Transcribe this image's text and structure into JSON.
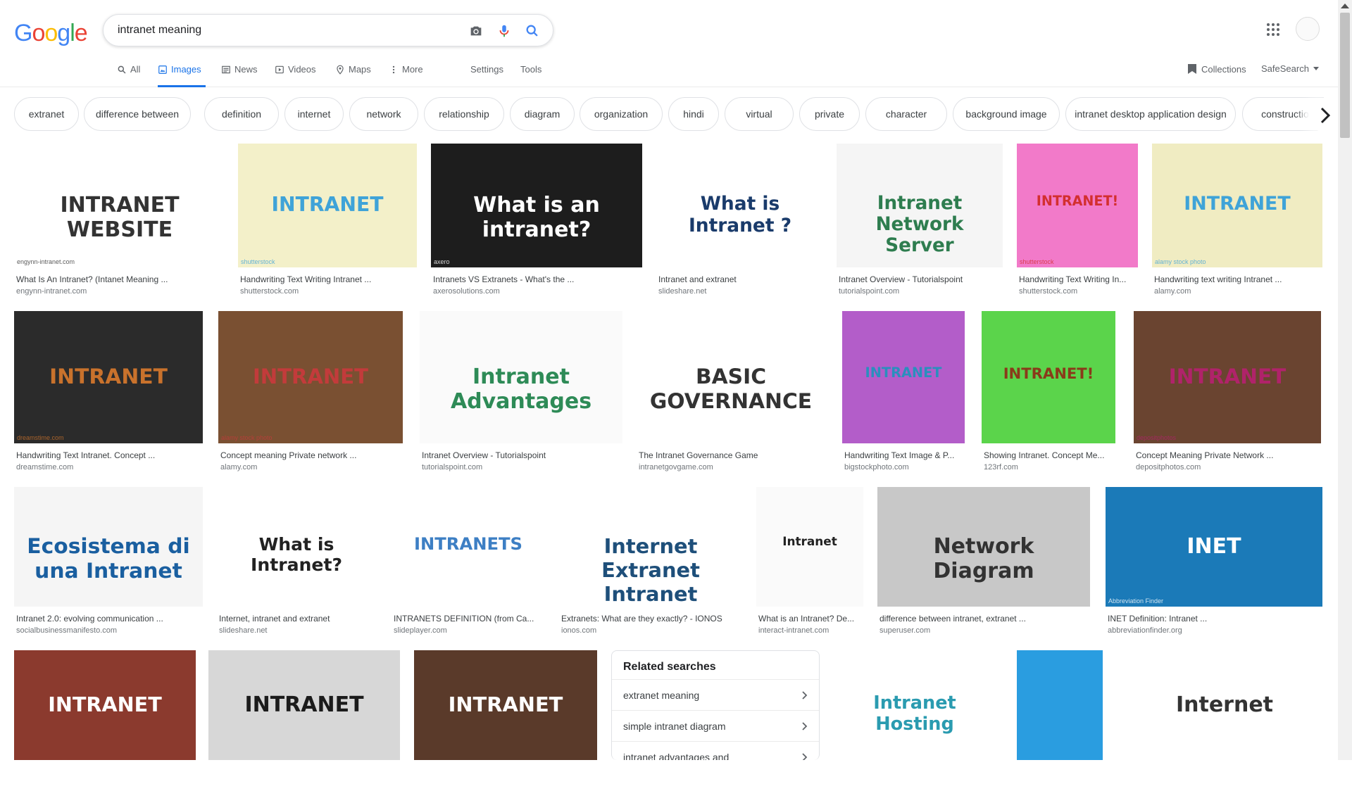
{
  "search": {
    "query": "intranet meaning"
  },
  "logo": {
    "letters": [
      "G",
      "o",
      "o",
      "g",
      "l",
      "e"
    ],
    "colors": [
      "#4285F4",
      "#EA4335",
      "#FBBC05",
      "#4285F4",
      "#34A853",
      "#EA4335"
    ]
  },
  "tabs": [
    {
      "label": "All",
      "icon": "search-icon"
    },
    {
      "label": "Images",
      "icon": "image-icon"
    },
    {
      "label": "News",
      "icon": "news-icon"
    },
    {
      "label": "Videos",
      "icon": "video-icon"
    },
    {
      "label": "Maps",
      "icon": "map-icon"
    },
    {
      "label": "More",
      "icon": "dots-icon"
    }
  ],
  "tools": {
    "settings": "Settings",
    "tools": "Tools",
    "collections": "Collections",
    "safesearch": "SafeSearch"
  },
  "chips": [
    "extranet",
    "difference between",
    "definition",
    "internet",
    "network",
    "relationship",
    "diagram",
    "organization",
    "hindi",
    "virtual",
    "private",
    "character",
    "background image",
    "intranet desktop application design",
    "construction com"
  ],
  "results": [
    {
      "caption": "What Is An Intranet? (Intanet Meaning ...",
      "source": "engynn-intranet.com",
      "bg": "#ffffff",
      "fg": "#333333",
      "text": "INTRANET   WEBSITE",
      "watermark": "engynn-intranet.com"
    },
    {
      "caption": "Handwriting Text Writing Intranet ...",
      "source": "shutterstock.com",
      "bg": "#f3f0c9",
      "fg": "#3fa3d8",
      "text": "INTRANET",
      "watermark": "shutterstock"
    },
    {
      "caption": "Intranets VS Extranets - What's the ...",
      "source": "axerosolutions.com",
      "bg": "#1d1d1d",
      "fg": "#ffffff",
      "text": "What is an intranet?",
      "watermark": "axero"
    },
    {
      "caption": "Intranet and extranet",
      "source": "slideshare.net",
      "bg": "#ffffff",
      "fg": "#1a3b6b",
      "text": "What is Intranet ?",
      "watermark": ""
    },
    {
      "caption": "Intranet Overview - Tutorialspoint",
      "source": "tutorialspoint.com",
      "bg": "#f5f5f5",
      "fg": "#2e7d4f",
      "text": "Intranet Network Server",
      "watermark": ""
    },
    {
      "caption": "Handwriting Text Writing In...",
      "source": "shutterstock.com",
      "bg": "#f27ac9",
      "fg": "#d32f2f",
      "text": "INTRANET!",
      "watermark": "shutterstock"
    },
    {
      "caption": "Handwriting text writing Intranet ...",
      "source": "alamy.com",
      "bg": "#f0ecc2",
      "fg": "#3fa3d8",
      "text": "INTRANET",
      "watermark": "alamy stock photo"
    },
    {
      "caption": "Handwriting Text Intranet. Concept ...",
      "source": "dreamstime.com",
      "bg": "#2b2b2b",
      "fg": "#c9722c",
      "text": "INTRANET",
      "watermark": "dreamstime.com"
    },
    {
      "caption": "Concept meaning Private network ...",
      "source": "alamy.com",
      "bg": "#7a5032",
      "fg": "#c23b3b",
      "text": "INTRANET",
      "watermark": "alamy stock photo"
    },
    {
      "caption": "Intranet Overview - Tutorialspoint",
      "source": "tutorialspoint.com",
      "bg": "#fafafa",
      "fg": "#2e8b57",
      "text": "Intranet Advantages",
      "watermark": ""
    },
    {
      "caption": "The Intranet Governance Game",
      "source": "intranetgovgame.com",
      "bg": "#ffffff",
      "fg": "#333333",
      "text": "BASIC GOVERNANCE",
      "watermark": ""
    },
    {
      "caption": "Handwriting Text Image & P...",
      "source": "bigstockphoto.com",
      "bg": "#b35dc9",
      "fg": "#2a8fbd",
      "text": "INTRANET",
      "watermark": ""
    },
    {
      "caption": "Showing Intranet. Concept Me...",
      "source": "123rf.com",
      "bg": "#5bd44b",
      "fg": "#8a3a1a",
      "text": "INTRANET!",
      "watermark": ""
    },
    {
      "caption": "Concept Meaning Private Network ...",
      "source": "depositphotos.com",
      "bg": "#6a4430",
      "fg": "#b0236a",
      "text": "INTRANET",
      "watermark": "depositphotos"
    },
    {
      "caption": "Intranet 2.0: evolving communication ...",
      "source": "socialbusinessmanifesto.com",
      "bg": "#f5f5f5",
      "fg": "#1a5fa0",
      "text": "Ecosistema di una Intranet",
      "watermark": ""
    },
    {
      "caption": "Internet, intranet and extranet",
      "source": "slideshare.net",
      "bg": "#ffffff",
      "fg": "#222222",
      "text": "What is Intranet?",
      "watermark": ""
    },
    {
      "caption": "INTRANETS DEFINITION (from Ca...",
      "source": "slideplayer.com",
      "bg": "#ffffff",
      "fg": "#3d7fc4",
      "text": "INTRANETS",
      "watermark": ""
    },
    {
      "caption": "Extranets: What are they exactly? - IONOS",
      "source": "ionos.com",
      "bg": "#ffffff",
      "fg": "#1e4f7a",
      "text": "Internet Extranet Intranet",
      "watermark": ""
    },
    {
      "caption": "What is an Intranet? De...",
      "source": "interact-intranet.com",
      "bg": "#fafafa",
      "fg": "#222222",
      "text": "Intranet",
      "watermark": ""
    },
    {
      "caption": "difference between intranet, extranet ...",
      "source": "superuser.com",
      "bg": "#c8c8c8",
      "fg": "#333333",
      "text": "Network Diagram",
      "watermark": ""
    },
    {
      "caption": "INET Definition: Intranet ...",
      "source": "abbreviationfinder.org",
      "bg": "#1b7ab8",
      "fg": "#ffffff",
      "text": "INET",
      "watermark": "Abbreviation Finder"
    },
    {
      "caption": "",
      "source": "",
      "bg": "#8b3a2e",
      "fg": "#ffffff",
      "text": "INTRANET",
      "watermark": ""
    },
    {
      "caption": "",
      "source": "",
      "bg": "#d7d7d7",
      "fg": "#1b1b1b",
      "text": "INTRANET",
      "watermark": ""
    },
    {
      "caption": "",
      "source": "",
      "bg": "#5a3a2a",
      "fg": "#ffffff",
      "text": "INTRANET",
      "watermark": ""
    },
    {
      "caption": "",
      "source": "",
      "bg": "#ffffff",
      "fg": "#2a9bb0",
      "text": "Intranet Hosting",
      "watermark": ""
    },
    {
      "caption": "",
      "source": "",
      "bg": "#2a9de0",
      "fg": "#ffffff",
      "text": "",
      "watermark": ""
    },
    {
      "caption": "",
      "source": "",
      "bg": "#ffffff",
      "fg": "#333333",
      "text": "Internet",
      "watermark": ""
    }
  ],
  "related": {
    "title": "Related searches",
    "items": [
      "extranet meaning",
      "simple intranet diagram",
      "intranet advantages and"
    ]
  }
}
